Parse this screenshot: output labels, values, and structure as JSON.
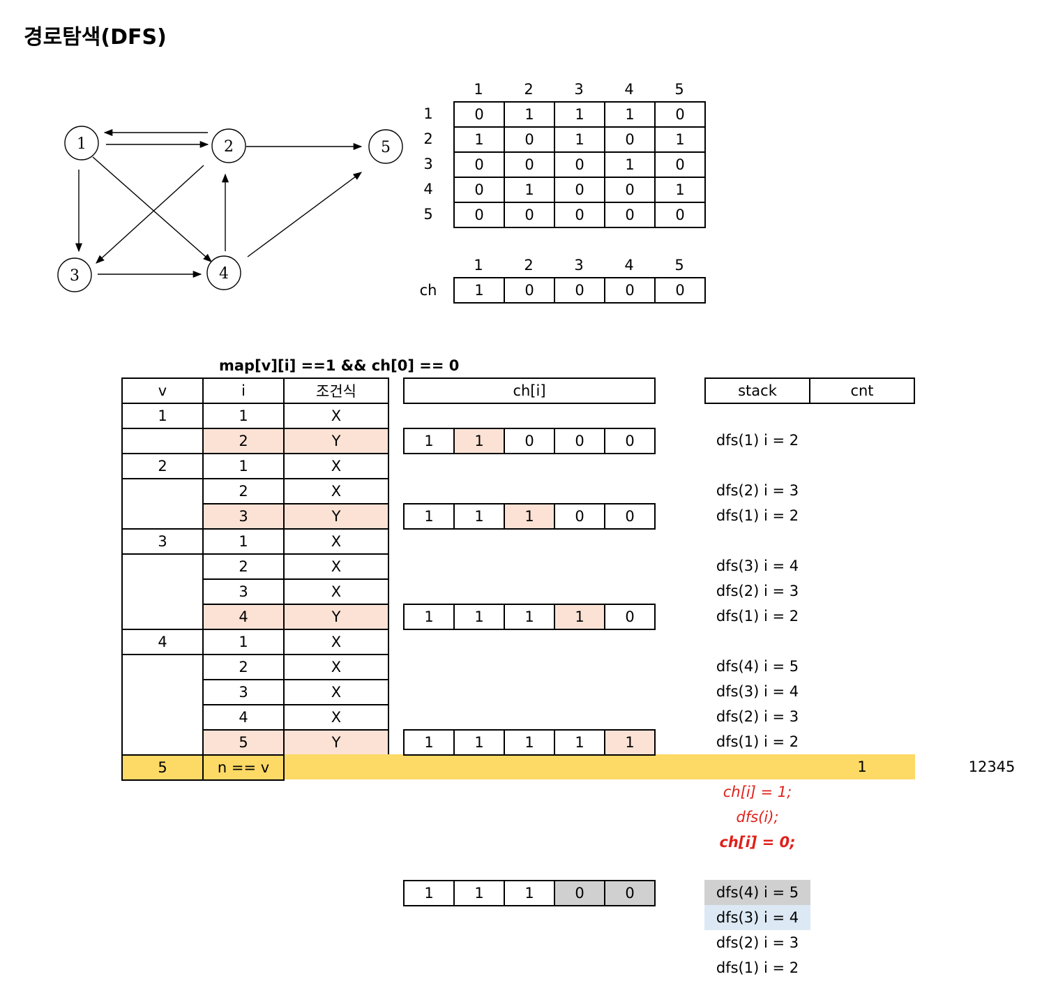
{
  "title": "경로탐색(DFS)",
  "graph": {
    "nodes": [
      "1",
      "2",
      "3",
      "4",
      "5"
    ],
    "edges": [
      [
        "1",
        "2"
      ],
      [
        "2",
        "1"
      ],
      [
        "1",
        "3"
      ],
      [
        "1",
        "4"
      ],
      [
        "2",
        "3"
      ],
      [
        "2",
        "5"
      ],
      [
        "3",
        "4"
      ],
      [
        "4",
        "2"
      ],
      [
        "4",
        "5"
      ]
    ]
  },
  "matrix": {
    "col_headers": [
      "1",
      "2",
      "3",
      "4",
      "5"
    ],
    "row_headers": [
      "1",
      "2",
      "3",
      "4",
      "5"
    ],
    "rows": [
      [
        "0",
        "1",
        "1",
        "1",
        "0"
      ],
      [
        "1",
        "0",
        "1",
        "0",
        "1"
      ],
      [
        "0",
        "0",
        "0",
        "1",
        "0"
      ],
      [
        "0",
        "1",
        "0",
        "0",
        "1"
      ],
      [
        "0",
        "0",
        "0",
        "0",
        "0"
      ]
    ]
  },
  "ch_array": {
    "col_headers": [
      "1",
      "2",
      "3",
      "4",
      "5"
    ],
    "row_label": "ch",
    "values": [
      "1",
      "0",
      "0",
      "0",
      "0"
    ]
  },
  "trace": {
    "condition": "map[v][i] ==1 && ch[0] == 0",
    "headers": {
      "v": "v",
      "i": "i",
      "cond": "조건식",
      "chi": "ch[i]",
      "stack": "stack",
      "cnt": "cnt"
    },
    "v_labels": [
      "1",
      "2",
      "3",
      "4",
      "5"
    ],
    "rows": [
      {
        "i": "1",
        "c": "X"
      },
      {
        "i": "2",
        "c": "Y"
      },
      {
        "i": "1",
        "c": "X"
      },
      {
        "i": "2",
        "c": "X"
      },
      {
        "i": "3",
        "c": "Y"
      },
      {
        "i": "1",
        "c": "X"
      },
      {
        "i": "2",
        "c": "X"
      },
      {
        "i": "3",
        "c": "X"
      },
      {
        "i": "4",
        "c": "Y"
      },
      {
        "i": "1",
        "c": "X"
      },
      {
        "i": "2",
        "c": "X"
      },
      {
        "i": "3",
        "c": "X"
      },
      {
        "i": "4",
        "c": "X"
      },
      {
        "i": "5",
        "c": "Y"
      }
    ],
    "final_i": "n == v",
    "ch_rows": [
      [
        "1",
        "1",
        "0",
        "0",
        "0"
      ],
      [
        "1",
        "1",
        "1",
        "0",
        "0"
      ],
      [
        "1",
        "1",
        "1",
        "1",
        "0"
      ],
      [
        "1",
        "1",
        "1",
        "1",
        "1"
      ]
    ],
    "stack_lines": [
      "dfs(1) i = 2",
      "dfs(2) i = 3",
      "dfs(1) i = 2",
      "dfs(3) i = 4",
      "dfs(2) i = 3",
      "dfs(1) i = 2",
      "dfs(4) i = 5",
      "dfs(3) i = 4",
      "dfs(2) i = 3",
      "dfs(1) i = 2"
    ],
    "cnt_value": "1",
    "path": "12345"
  },
  "code": [
    "ch[i] = 1;",
    "dfs(i);",
    "ch[i] = 0;"
  ],
  "backtrack": {
    "ch_values": [
      "1",
      "1",
      "1",
      "0",
      "0"
    ],
    "stack": [
      "dfs(4) i = 5",
      "dfs(3) i = 4",
      "dfs(2) i = 3",
      "dfs(1) i = 2"
    ]
  },
  "colors": {
    "highlight": "#fbe2d5",
    "final_row": "#fdd966",
    "unset": "#d0d0d0",
    "current": "#dce9f5",
    "code_red": "#e0201a"
  }
}
